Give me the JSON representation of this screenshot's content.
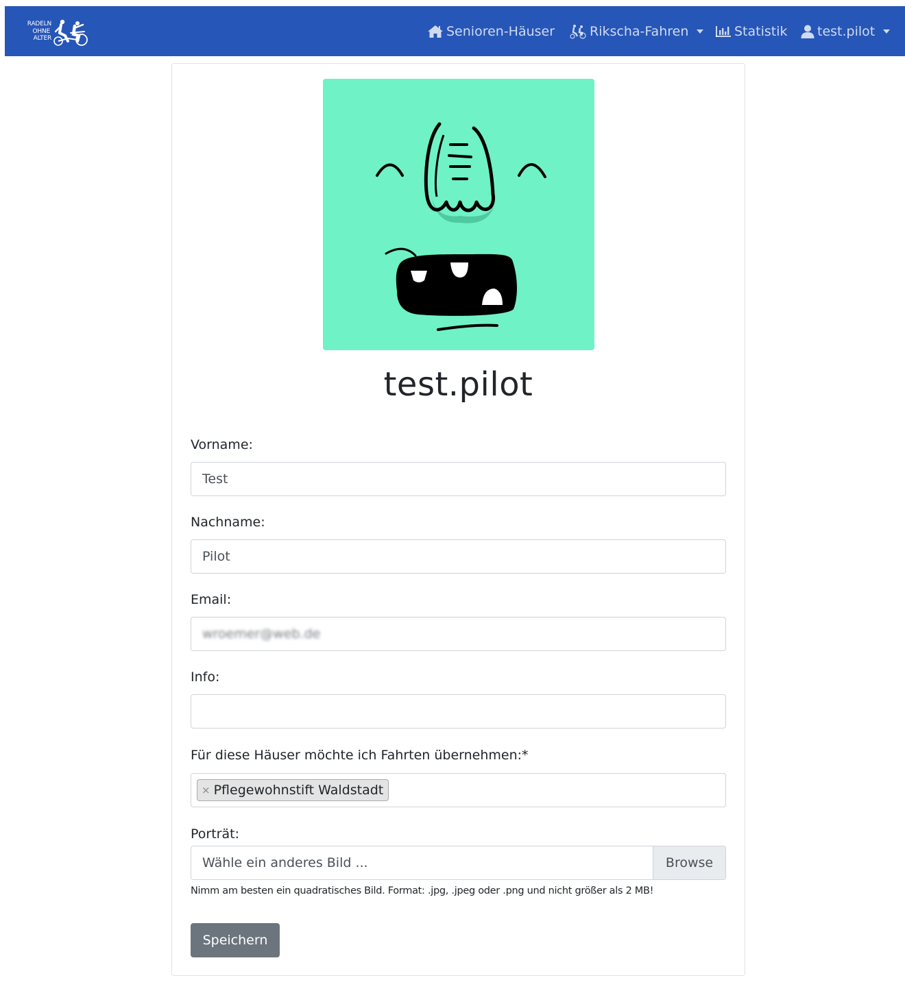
{
  "navbar": {
    "brand": {
      "line1": "RADELN",
      "line2": "OHNE",
      "line3": "ALTER"
    },
    "items": [
      {
        "label": "Senioren-Häuser",
        "icon": "home-icon"
      },
      {
        "label": "Rikscha-Fahren",
        "icon": "rickshaw-icon",
        "dropdown": true
      },
      {
        "label": "Statistik",
        "icon": "bar-chart-icon"
      },
      {
        "label": "test.pilot",
        "icon": "user-icon",
        "dropdown": true
      }
    ]
  },
  "profile": {
    "username": "test.pilot",
    "avatar": "monster-face-avatar"
  },
  "form": {
    "firstname": {
      "label": "Vorname:",
      "value": "Test"
    },
    "lastname": {
      "label": "Nachname:",
      "value": "Pilot"
    },
    "email": {
      "label": "Email:",
      "value": "wroemer@web.de"
    },
    "info": {
      "label": "Info:",
      "value": ""
    },
    "houses": {
      "label": "Für diese Häuser möchte ich Fahrten übernehmen:*",
      "remove_symbol": "×",
      "selected": [
        "Pflegewohnstift Waldstadt"
      ]
    },
    "portrait": {
      "label": "Porträt:",
      "placeholder": "Wähle ein anderes Bild ...",
      "browse": "Browse",
      "help": "Nimm am besten ein quadratisches Bild. Format: .jpg, .jpeg oder .png und nicht größer als 2 MB!"
    },
    "save": "Speichern"
  },
  "colors": {
    "navbar": "#2656b7",
    "avatar_bg": "#6ff2c5",
    "save_button": "#6c757d"
  }
}
